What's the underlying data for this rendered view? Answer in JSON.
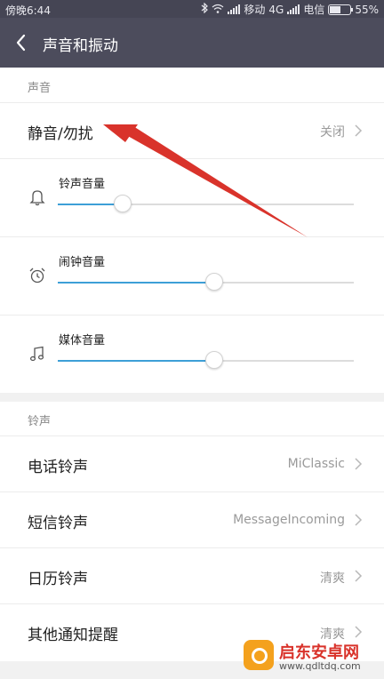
{
  "status_bar": {
    "time": "傍晚6:44",
    "carrier1": "移动",
    "network": "4G",
    "carrier2": "电信",
    "battery": "55%",
    "battery_level": 0.55
  },
  "header": {
    "title": "声音和振动"
  },
  "sound": {
    "section_label": "声音",
    "dnd": {
      "label": "静音/勿扰",
      "value": "关闭"
    },
    "volumes": [
      {
        "label": "铃声音量",
        "icon": "bell-icon",
        "level": 0.22
      },
      {
        "label": "闹钟音量",
        "icon": "alarm-clock-icon",
        "level": 0.53
      },
      {
        "label": "媒体音量",
        "icon": "music-note-icon",
        "level": 0.53
      }
    ]
  },
  "ringtones": {
    "section_label": "铃声",
    "items": [
      {
        "label": "电话铃声",
        "value": "MiClassic"
      },
      {
        "label": "短信铃声",
        "value": "MessageIncoming"
      },
      {
        "label": "日历铃声",
        "value": "清爽"
      },
      {
        "label": "其他通知提醒",
        "value": "清爽"
      }
    ]
  },
  "watermark": {
    "title": "启东安卓网",
    "url": "www.qdltdq.com"
  },
  "colors": {
    "accent": "#3d9fd7",
    "header": "#4c4c5c",
    "status_bar": "#454554",
    "arrow": "#d9332b"
  }
}
